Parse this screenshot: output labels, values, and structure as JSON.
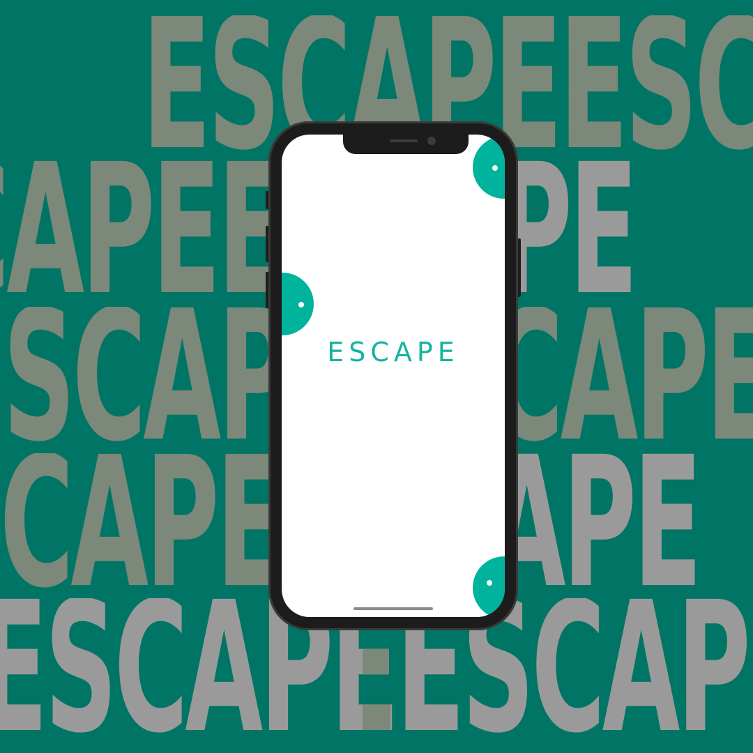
{
  "background": {
    "word": "ESCAPE",
    "color": "#007565",
    "text_colors": [
      "#7c8879",
      "#9a9a9a"
    ],
    "rows": [
      {
        "text": "ESCAPEESCAPE"
      },
      {
        "text": "ESCAPEESCAPE"
      },
      {
        "text": "ESCAPEESCAPE"
      },
      {
        "text": "ESCAPEESCAPE"
      },
      {
        "text": "ESCAPEESCAPE"
      }
    ]
  },
  "phone": {
    "screen": {
      "title": "ESCAPE",
      "title_color": "#17b3a0",
      "accent_color": "#00b39c"
    }
  }
}
